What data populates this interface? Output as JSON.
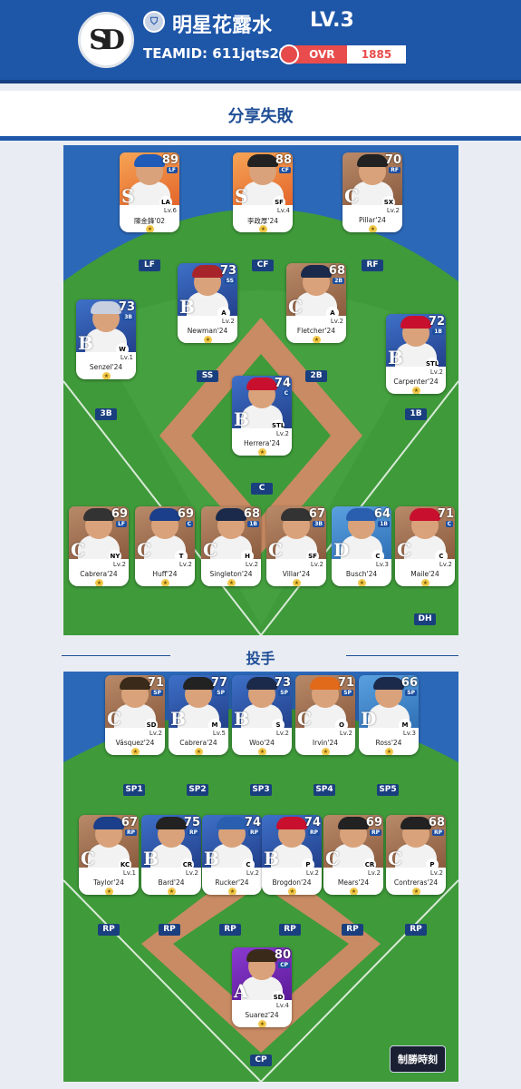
{
  "header": {
    "team_name": "明星花露水",
    "level": "LV.3",
    "team_id": "TEAMID: 611jqts25",
    "ovr_label": "OVR",
    "ovr_value": "1885",
    "logo_text": "SD"
  },
  "banner": {
    "title": "分享失敗"
  },
  "sections": {
    "pitchers_title": "投手"
  },
  "colors": {
    "header_blue": "#1e56a8",
    "field_blue": "#2b68b8",
    "grass": "#3f9a3a",
    "dirt": "#c98b63",
    "ovr_red": "#e84c4c"
  },
  "hitters": [
    {
      "name": "陳金鋒'02",
      "rating": "89",
      "pos_mini": "LF",
      "lv": "Lv.6",
      "grade": "S",
      "tier": "S",
      "slot": "LF",
      "cap": "#1f5bb8",
      "logo": "LA"
    },
    {
      "name": "李政厚'24",
      "rating": "88",
      "pos_mini": "CF",
      "lv": "Lv.4",
      "grade": "S",
      "tier": "S",
      "slot": "CF",
      "cap": "#222222",
      "logo": "SF"
    },
    {
      "name": "Pillar'24",
      "rating": "70",
      "pos_mini": "RF",
      "lv": "Lv.2",
      "grade": "C",
      "tier": "C",
      "slot": "RF",
      "cap": "#222222",
      "logo": "SX"
    },
    {
      "name": "Newman'24",
      "rating": "73",
      "pos_mini": "SS",
      "lv": "Lv.2",
      "grade": "B",
      "tier": "B",
      "slot": "SS",
      "cap": "#a8242b",
      "logo": "A"
    },
    {
      "name": "Fletcher'24",
      "rating": "68",
      "pos_mini": "2B",
      "lv": "Lv.2",
      "grade": "C",
      "tier": "C",
      "slot": "2B",
      "cap": "#1b2a4a",
      "logo": "A"
    },
    {
      "name": "Senzel'24",
      "rating": "73",
      "pos_mini": "3B",
      "lv": "Lv.1",
      "grade": "B",
      "tier": "B",
      "slot": "3B",
      "cap": "#c8d0e0",
      "logo": "W"
    },
    {
      "name": "Carpenter'24",
      "rating": "72",
      "pos_mini": "1B",
      "lv": "Lv.2",
      "grade": "B",
      "tier": "B",
      "slot": "1B",
      "cap": "#c8102e",
      "logo": "STL"
    },
    {
      "name": "Herrera'24",
      "rating": "74",
      "pos_mini": "C",
      "lv": "Lv.2",
      "grade": "B",
      "tier": "B",
      "slot": "C",
      "cap": "#c8102e",
      "logo": "STL"
    },
    {
      "name": "Cabrera'24",
      "rating": "69",
      "pos_mini": "LF",
      "lv": "Lv.2",
      "grade": "C",
      "tier": "C",
      "slot": "",
      "cap": "#333333",
      "logo": "NY"
    },
    {
      "name": "Huff'24",
      "rating": "69",
      "pos_mini": "C",
      "lv": "Lv.2",
      "grade": "C",
      "tier": "C",
      "slot": "",
      "cap": "#1b3f8a",
      "logo": "T"
    },
    {
      "name": "Singleton'24",
      "rating": "68",
      "pos_mini": "1B",
      "lv": "Lv.2",
      "grade": "C",
      "tier": "C",
      "slot": "",
      "cap": "#1b2a4a",
      "logo": "H"
    },
    {
      "name": "Villar'24",
      "rating": "67",
      "pos_mini": "3B",
      "lv": "Lv.2",
      "grade": "C",
      "tier": "C",
      "slot": "",
      "cap": "#333333",
      "logo": "SF"
    },
    {
      "name": "Busch'24",
      "rating": "64",
      "pos_mini": "1B",
      "lv": "Lv.3",
      "grade": "D",
      "tier": "D",
      "slot": "",
      "cap": "#2a5fb0",
      "logo": "C"
    },
    {
      "name": "Maile'24",
      "rating": "71",
      "pos_mini": "C",
      "lv": "Lv.2",
      "grade": "C",
      "tier": "C",
      "slot": "DH",
      "cap": "#c8102e",
      "logo": "C"
    }
  ],
  "pitchers": [
    {
      "name": "Vásquez'24",
      "rating": "71",
      "pos_mini": "SP",
      "lv": "Lv.2",
      "grade": "C",
      "tier": "C",
      "slot": "SP1",
      "cap": "#3a2a1a",
      "logo": "SD"
    },
    {
      "name": "Cabrera'24",
      "rating": "77",
      "pos_mini": "SP",
      "lv": "Lv.5",
      "grade": "B",
      "tier": "B",
      "slot": "SP2",
      "cap": "#222222",
      "logo": "M"
    },
    {
      "name": "Woo'24",
      "rating": "73",
      "pos_mini": "SP",
      "lv": "Lv.2",
      "grade": "B",
      "tier": "B",
      "slot": "SP3",
      "cap": "#1b2a4a",
      "logo": "S"
    },
    {
      "name": "Irvin'24",
      "rating": "71",
      "pos_mini": "SP",
      "lv": "Lv.2",
      "grade": "C",
      "tier": "C",
      "slot": "SP4",
      "cap": "#e06a1a",
      "logo": "O"
    },
    {
      "name": "Ross'24",
      "rating": "66",
      "pos_mini": "SP",
      "lv": "Lv.3",
      "grade": "D",
      "tier": "D",
      "slot": "SP5",
      "cap": "#1b2a4a",
      "logo": "M"
    },
    {
      "name": "Taylor'24",
      "rating": "67",
      "pos_mini": "RP",
      "lv": "Lv.1",
      "grade": "C",
      "tier": "C",
      "slot": "RP",
      "cap": "#1b3f8a",
      "logo": "KC"
    },
    {
      "name": "Bard'24",
      "rating": "75",
      "pos_mini": "RP",
      "lv": "Lv.2",
      "grade": "B",
      "tier": "B",
      "slot": "RP",
      "cap": "#222222",
      "logo": "CR"
    },
    {
      "name": "Rucker'24",
      "rating": "74",
      "pos_mini": "RP",
      "lv": "Lv.2",
      "grade": "B",
      "tier": "B",
      "slot": "RP",
      "cap": "#2a5fb0",
      "logo": "C"
    },
    {
      "name": "Brogdon'24",
      "rating": "74",
      "pos_mini": "RP",
      "lv": "Lv.2",
      "grade": "B",
      "tier": "B",
      "slot": "RP",
      "cap": "#c8102e",
      "logo": "P"
    },
    {
      "name": "Mears'24",
      "rating": "69",
      "pos_mini": "RP",
      "lv": "Lv.2",
      "grade": "C",
      "tier": "C",
      "slot": "RP",
      "cap": "#222222",
      "logo": "CR"
    },
    {
      "name": "Contreras'24",
      "rating": "68",
      "pos_mini": "RP",
      "lv": "Lv.2",
      "grade": "C",
      "tier": "C",
      "slot": "RP",
      "cap": "#222222",
      "logo": "P"
    },
    {
      "name": "Suarez'24",
      "rating": "80",
      "pos_mini": "CP",
      "lv": "Lv.4",
      "grade": "A",
      "tier": "A",
      "slot": "CP",
      "cap": "#3a2a1a",
      "logo": "SD"
    }
  ],
  "watermark": "制勝時刻"
}
